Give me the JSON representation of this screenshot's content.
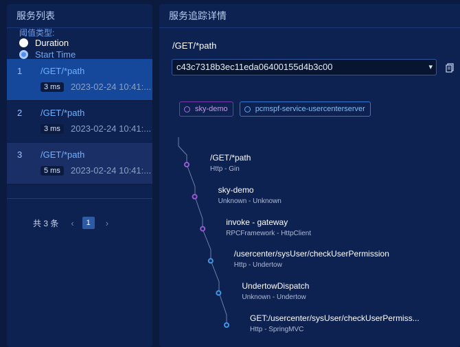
{
  "left_panel": {
    "title": "服务列表",
    "threshold_label": "阈值类型:",
    "options": [
      {
        "label": "Duration",
        "selected": false
      },
      {
        "label": "Start Time",
        "selected": true
      }
    ],
    "services": [
      {
        "index": "1",
        "path": "/GET/*path",
        "duration": "3 ms",
        "time": "2023-02-24 10:41:...",
        "state": "selected"
      },
      {
        "index": "2",
        "path": "/GET/*path",
        "duration": "3 ms",
        "time": "2023-02-24 10:41:...",
        "state": "normal"
      },
      {
        "index": "3",
        "path": "/GET/*path",
        "duration": "5 ms",
        "time": "2023-02-24 10:41:...",
        "state": "hover"
      }
    ],
    "pagination": {
      "total": "共 3 条",
      "prev": "‹",
      "page": "1",
      "next": "›"
    }
  },
  "right_panel": {
    "title": "服务追踪详情",
    "trace_path": "/GET/*path",
    "trace_id": "c43c7318b3ec11eda06400155d4b3c00",
    "services": [
      {
        "name": "sky-demo",
        "color": "#b070e0"
      },
      {
        "name": "pcmspf-service-usercenterserver",
        "color": "#5aa8f5"
      }
    ],
    "spans": [
      {
        "name": "/GET/*path",
        "sub": "Http - Gin",
        "color": "#9a5bd0"
      },
      {
        "name": "sky-demo",
        "sub": "Unknown - Unknown",
        "color": "#9a5bd0"
      },
      {
        "name": "invoke - gateway",
        "sub": "RPCFramework - HttpClient",
        "color": "#9a5bd0"
      },
      {
        "name": "/usercenter/sysUser/checkUserPermission",
        "sub": "Http - Undertow",
        "color": "#3a9ae8"
      },
      {
        "name": "UndertowDispatch",
        "sub": "Unknown - Undertow",
        "color": "#3a9ae8"
      },
      {
        "name": "GET:/usercenter/sysUser/checkUserPermiss...",
        "sub": "Http - SpringMVC",
        "color": "#3a9ae8"
      }
    ]
  },
  "icons": {
    "copy": "copy-icon",
    "dropdown": "chevron-down-icon",
    "service_tag": "circle-icon"
  }
}
